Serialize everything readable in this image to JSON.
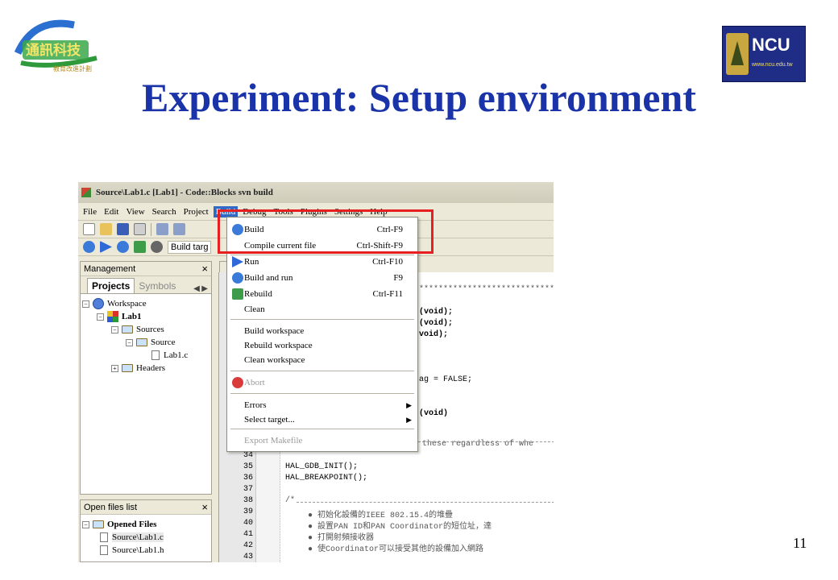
{
  "slide": {
    "title": "Experiment: Setup environment",
    "page_number": "11",
    "left_logo_text": "通訊科技",
    "left_logo_subtext": "教育改進計劃",
    "right_logo_text": "NCU",
    "right_logo_url": "www.ncu.edu.tw"
  },
  "window": {
    "title": "Source\\Lab1.c [Lab1] - Code::Blocks svn build",
    "menu": [
      "File",
      "Edit",
      "View",
      "Search",
      "Project",
      "Build",
      "Debug",
      "Tools",
      "Plugins",
      "Settings",
      "Help"
    ],
    "build_target_label": "Build targ"
  },
  "management": {
    "title": "Management",
    "close": "×",
    "tabs": [
      "Projects",
      "Symbols"
    ],
    "tree": {
      "workspace": "Workspace",
      "project": "Lab1",
      "sources": "Sources",
      "source": "Source",
      "file": "Lab1.c",
      "headers": "Headers"
    }
  },
  "open_files": {
    "title": "Open files list",
    "close": "×",
    "group": "Opened Files",
    "files": [
      "Source\\Lab1.c",
      "Source\\Lab1.h"
    ]
  },
  "build_menu": {
    "items": [
      {
        "label": "Build",
        "shortcut": "Ctrl-F9"
      },
      {
        "label": "Compile current file",
        "shortcut": "Ctrl-Shift-F9"
      },
      {
        "label": "Run",
        "shortcut": "Ctrl-F10"
      },
      {
        "label": "Build and run",
        "shortcut": "F9"
      },
      {
        "label": "Rebuild",
        "shortcut": "Ctrl-F11"
      },
      {
        "label": "Clean",
        "shortcut": ""
      },
      {
        "label": "Build workspace",
        "shortcut": ""
      },
      {
        "label": "Rebuild workspace",
        "shortcut": ""
      },
      {
        "label": "Clean workspace",
        "shortcut": ""
      },
      {
        "label": "Abort",
        "shortcut": ""
      },
      {
        "label": "Errors",
        "shortcut": ""
      },
      {
        "label": "Select target...",
        "shortcut": ""
      },
      {
        "label": "Export Makefile",
        "shortcut": ""
      }
    ]
  },
  "editor": {
    "code_fragments": {
      "stars": "**********************************",
      "void1": "(void);",
      "void2": "(void);",
      "void3": "void);",
      "flag": "ag = FALSE;",
      "void4": "(void)",
      "regardless": "these regardless of whe",
      "init": "HAL_GDB_INIT();",
      "bp": "HAL_BREAKPOINT();",
      "comment_open": "/*"
    },
    "line_numbers": [
      "34",
      "35",
      "36",
      "37",
      "38",
      "39",
      "40",
      "41",
      "42",
      "43"
    ],
    "bullets": [
      "初始化設備的IEEE 802.15.4的堆疊",
      "設置PAN ID和PAN Coordinator的短位址，達",
      "打開射頻接收器",
      "使Coordinator可以接受其他的設備加入網路"
    ]
  },
  "colors": {
    "title_blue": "#1a33a8",
    "highlight_red": "#e62020",
    "menu_selection": "#316ac5"
  }
}
